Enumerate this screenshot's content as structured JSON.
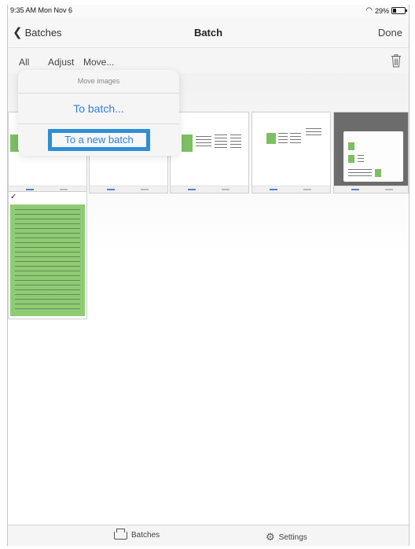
{
  "status": {
    "time": "9:35 AM  Mon Nov 6",
    "battery": "29%"
  },
  "nav": {
    "back_label": "Batches",
    "title": "Batch",
    "done_label": "Done"
  },
  "toolbar": {
    "all_label": "All",
    "adjust_label": "Adjust",
    "move_label": "Move..."
  },
  "popover": {
    "title": "Move images",
    "to_batch": "To batch...",
    "to_new_batch": "To a new batch"
  },
  "tabs": {
    "batches": "Batches",
    "settings": "Settings"
  },
  "icons": [
    "chevron-left-icon",
    "wifi-icon",
    "battery-icon",
    "trash-icon",
    "checkmark-icon",
    "tray-icon",
    "gear-icon"
  ],
  "colors": {
    "accent": "#2f7fe0",
    "selection_border": "#2d8fd6",
    "document_green": "#8fcb74"
  }
}
